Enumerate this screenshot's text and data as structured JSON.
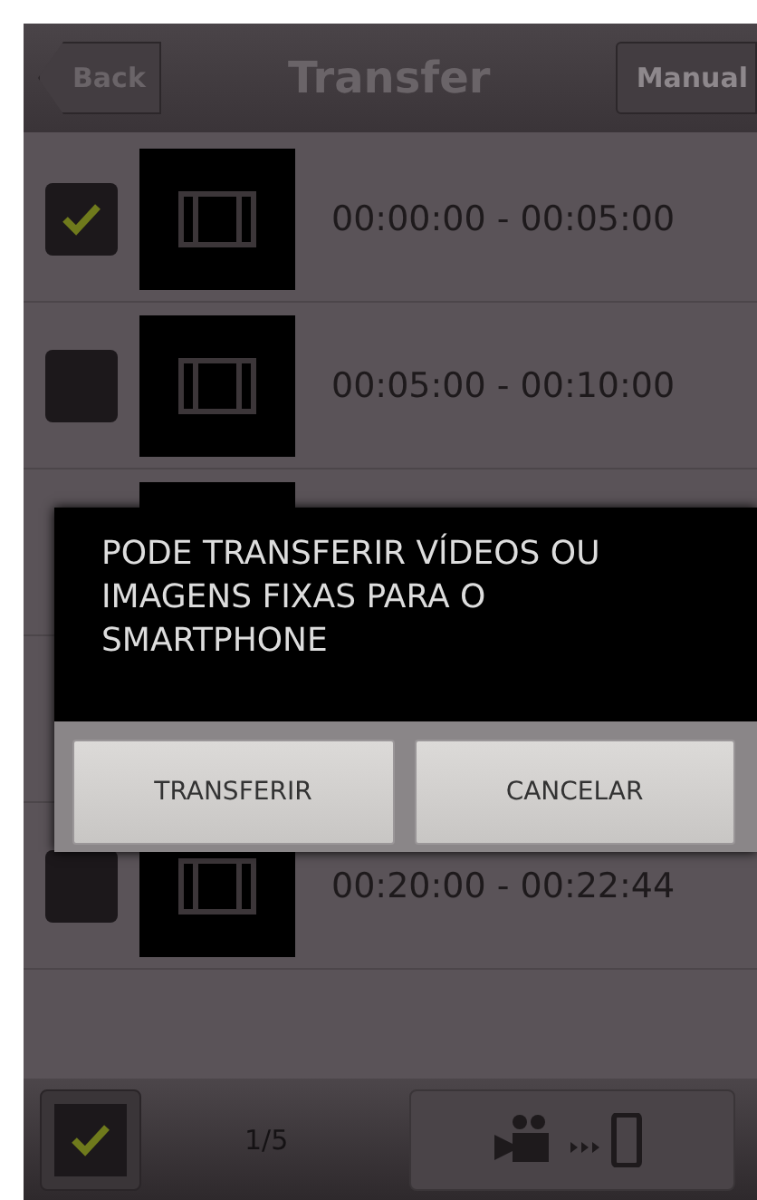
{
  "header": {
    "back": "Back",
    "title": "Transfer",
    "manual": "Manual"
  },
  "rows": [
    {
      "checked": true,
      "time": "00:00:00 - 00:05:00"
    },
    {
      "checked": false,
      "time": "00:05:00 - 00:10:00"
    },
    {},
    {},
    {
      "checked": false,
      "time": "00:20:00 - 00:22:44"
    }
  ],
  "dialog": {
    "message": "PODE TRANSFERIR VÍDEOS OU IMAGENS FIXAS PARA O SMARTPHONE",
    "buttons": [
      "TRANSFERIR",
      "CANCELAR"
    ]
  },
  "footer": {
    "select_all": {
      "checked": true
    },
    "page": "1/5"
  }
}
